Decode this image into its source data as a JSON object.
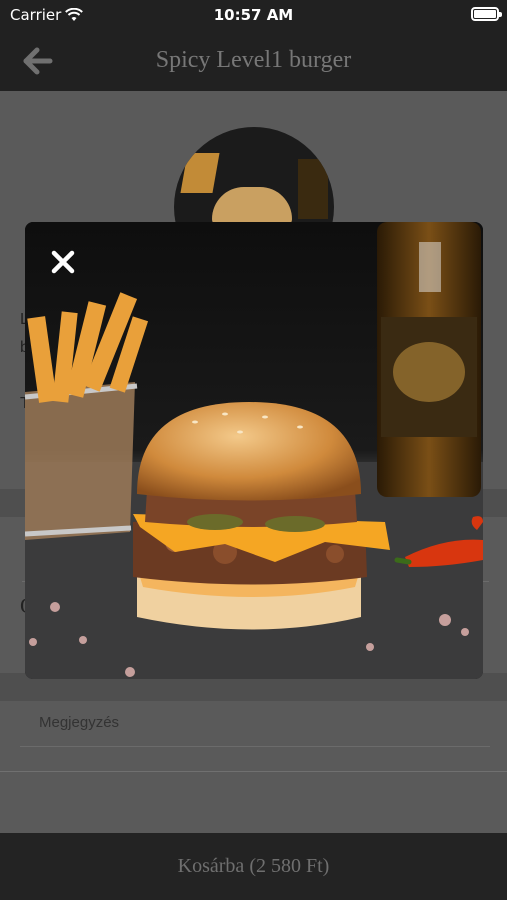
{
  "status_bar": {
    "carrier": "Carrier",
    "time": "10:57 AM"
  },
  "nav": {
    "title": "Spicy Level1 burger"
  },
  "form": {
    "note_placeholder": "Megjegyzés"
  },
  "peek_letters": [
    "L",
    "b",
    "T",
    "O"
  ],
  "cart": {
    "label": "Kosárba (2 580 Ft)"
  },
  "icons": {
    "back": "arrow-left-icon",
    "close": "close-icon",
    "wifi": "wifi-icon",
    "battery": "battery-icon"
  }
}
